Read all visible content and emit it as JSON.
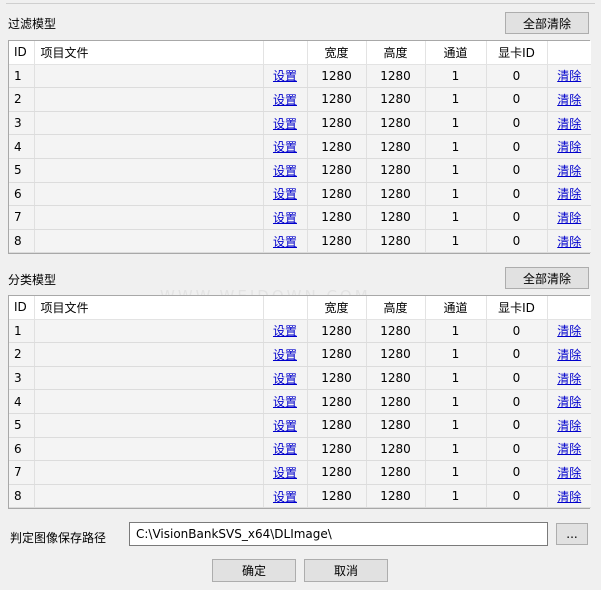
{
  "filter_section": {
    "title": "过滤模型",
    "clear_all_label": "全部清除",
    "columns": {
      "id": "ID",
      "file": "项目文件",
      "set": "",
      "width": "宽度",
      "height": "高度",
      "channel": "通道",
      "gpu": "显卡ID",
      "clear": ""
    },
    "rows": [
      {
        "id": "1",
        "file": "",
        "set": "设置",
        "width": "1280",
        "height": "1280",
        "channel": "1",
        "gpu": "0",
        "clear": "清除"
      },
      {
        "id": "2",
        "file": "",
        "set": "设置",
        "width": "1280",
        "height": "1280",
        "channel": "1",
        "gpu": "0",
        "clear": "清除"
      },
      {
        "id": "3",
        "file": "",
        "set": "设置",
        "width": "1280",
        "height": "1280",
        "channel": "1",
        "gpu": "0",
        "clear": "清除"
      },
      {
        "id": "4",
        "file": "",
        "set": "设置",
        "width": "1280",
        "height": "1280",
        "channel": "1",
        "gpu": "0",
        "clear": "清除"
      },
      {
        "id": "5",
        "file": "",
        "set": "设置",
        "width": "1280",
        "height": "1280",
        "channel": "1",
        "gpu": "0",
        "clear": "清除"
      },
      {
        "id": "6",
        "file": "",
        "set": "设置",
        "width": "1280",
        "height": "1280",
        "channel": "1",
        "gpu": "0",
        "clear": "清除"
      },
      {
        "id": "7",
        "file": "",
        "set": "设置",
        "width": "1280",
        "height": "1280",
        "channel": "1",
        "gpu": "0",
        "clear": "清除"
      },
      {
        "id": "8",
        "file": "",
        "set": "设置",
        "width": "1280",
        "height": "1280",
        "channel": "1",
        "gpu": "0",
        "clear": "清除"
      }
    ]
  },
  "classify_section": {
    "title": "分类模型",
    "clear_all_label": "全部清除",
    "columns": {
      "id": "ID",
      "file": "项目文件",
      "set": "",
      "width": "宽度",
      "height": "高度",
      "channel": "通道",
      "gpu": "显卡ID",
      "clear": ""
    },
    "rows": [
      {
        "id": "1",
        "file": "",
        "set": "设置",
        "width": "1280",
        "height": "1280",
        "channel": "1",
        "gpu": "0",
        "clear": "清除"
      },
      {
        "id": "2",
        "file": "",
        "set": "设置",
        "width": "1280",
        "height": "1280",
        "channel": "1",
        "gpu": "0",
        "clear": "清除"
      },
      {
        "id": "3",
        "file": "",
        "set": "设置",
        "width": "1280",
        "height": "1280",
        "channel": "1",
        "gpu": "0",
        "clear": "清除"
      },
      {
        "id": "4",
        "file": "",
        "set": "设置",
        "width": "1280",
        "height": "1280",
        "channel": "1",
        "gpu": "0",
        "clear": "清除"
      },
      {
        "id": "5",
        "file": "",
        "set": "设置",
        "width": "1280",
        "height": "1280",
        "channel": "1",
        "gpu": "0",
        "clear": "清除"
      },
      {
        "id": "6",
        "file": "",
        "set": "设置",
        "width": "1280",
        "height": "1280",
        "channel": "1",
        "gpu": "0",
        "clear": "清除"
      },
      {
        "id": "7",
        "file": "",
        "set": "设置",
        "width": "1280",
        "height": "1280",
        "channel": "1",
        "gpu": "0",
        "clear": "清除"
      },
      {
        "id": "8",
        "file": "",
        "set": "设置",
        "width": "1280",
        "height": "1280",
        "channel": "1",
        "gpu": "0",
        "clear": "清除"
      }
    ]
  },
  "save_path": {
    "label": "判定图像保存路径",
    "value": "C:\\VisionBankSVS_x64\\DLImage\\",
    "browse_label": "..."
  },
  "buttons": {
    "ok_label": "确定",
    "cancel_label": "取消"
  },
  "watermark_text": "WWW.WEIDOWN.COM"
}
